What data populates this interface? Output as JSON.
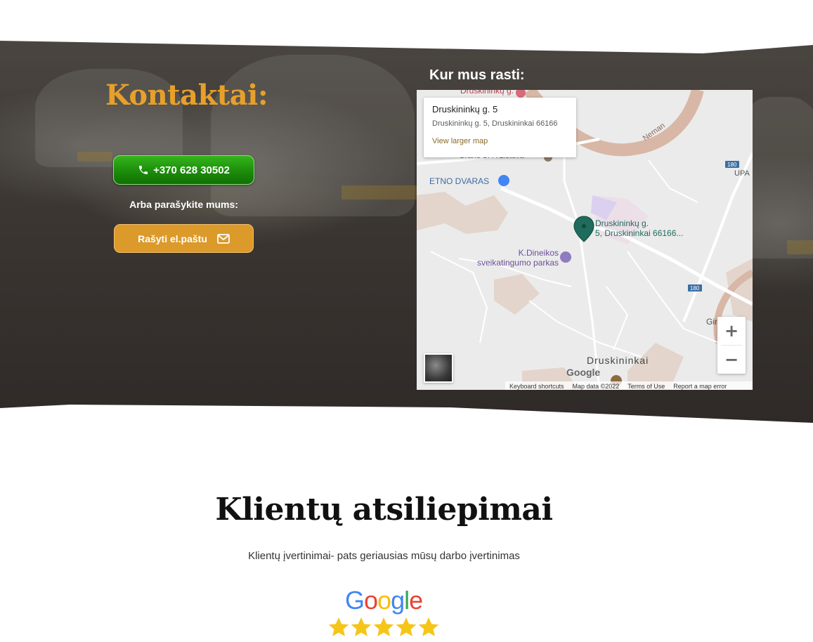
{
  "contact": {
    "title": "Kontaktai:",
    "phone_label": "+370 628 30502",
    "write_label": "Arba parašykite mums:",
    "email_label": "Rašyti el.paštu"
  },
  "map": {
    "section_title": "Kur mus rasti:",
    "info_card": {
      "title": "Druskininkų g. 5",
      "address": "Druskininkų g. 5, Druskininkai 66166",
      "link": "View larger map"
    },
    "labels": {
      "top_partial": "Druskininkų g.",
      "grand_spa": "Grand SPA Lietuva",
      "etno": "ETNO DVARAS",
      "marker_line1": "Druskininkų g.",
      "marker_line2": "5, Druskininkai 66166...",
      "park_line1": "K.Dineikos",
      "park_line2": "sveikatingumo parkas",
      "neman": "Neman",
      "upa": "UPA",
      "route_180_a": "180",
      "route_180_b": "180",
      "girios": "Girios dai",
      "city": "Druskininkai"
    },
    "zoom_in": "+",
    "zoom_out": "−",
    "footer": {
      "shortcuts": "Keyboard shortcuts",
      "data": "Map data ©2022",
      "terms": "Terms of Use",
      "report": "Report a map error"
    },
    "google_text": "Google"
  },
  "reviews": {
    "title": "Klientų atsiliepimai",
    "subtitle": "Klientų įvertinimai- pats geriausias mūsų darbo įvertinimas",
    "google_letters": [
      "G",
      "o",
      "o",
      "g",
      "l",
      "e"
    ],
    "rating": 5
  },
  "colors": {
    "accent_gold": "#e7a02a",
    "phone_green": "#1c8c0a",
    "email_orange": "#dc9a2a",
    "star_yellow": "#f5c518"
  }
}
